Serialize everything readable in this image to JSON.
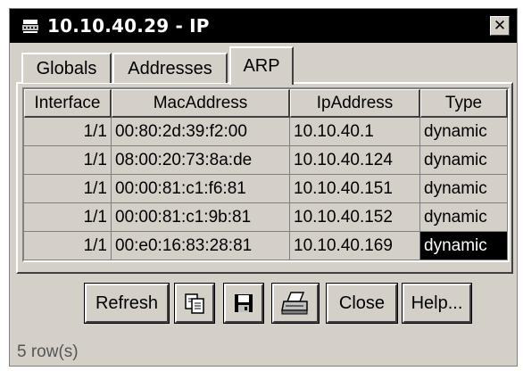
{
  "window": {
    "title": "10.10.40.29 - IP",
    "close_glyph": "✕"
  },
  "tabs": [
    {
      "label": "Globals",
      "selected": false
    },
    {
      "label": "Addresses",
      "selected": false
    },
    {
      "label": "ARP",
      "selected": true
    }
  ],
  "table": {
    "columns": [
      "Interface",
      "MacAddress",
      "IpAddress",
      "Type"
    ],
    "rows": [
      {
        "interface": "1/1",
        "mac": "00:80:2d:39:f2:00",
        "ip": "10.10.40.1",
        "type": "dynamic"
      },
      {
        "interface": "1/1",
        "mac": "08:00:20:73:8a:de",
        "ip": "10.10.40.124",
        "type": "dynamic"
      },
      {
        "interface": "1/1",
        "mac": "00:00:81:c1:f6:81",
        "ip": "10.10.40.151",
        "type": "dynamic"
      },
      {
        "interface": "1/1",
        "mac": "00:00:81:c1:9b:81",
        "ip": "10.10.40.152",
        "type": "dynamic"
      },
      {
        "interface": "1/1",
        "mac": "00:e0:16:83:28:81",
        "ip": "10.10.40.169",
        "type": "dynamic"
      }
    ]
  },
  "buttons": {
    "refresh": "Refresh",
    "copy_icon": "copy-icon",
    "save_icon": "save-icon",
    "print_icon": "print-icon",
    "close": "Close",
    "help": "Help..."
  },
  "status": {
    "text": "5 row(s)"
  },
  "colors": {
    "title_bg": "#000000",
    "face": "#d4d0c8",
    "selected_bg": "#000000",
    "selected_fg": "#ffffff"
  }
}
